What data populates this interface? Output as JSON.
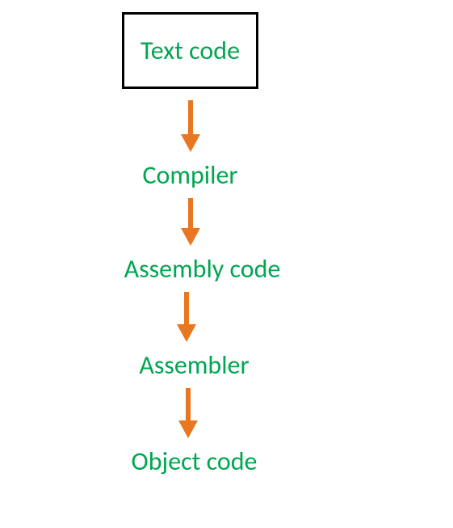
{
  "diagram": {
    "nodes": [
      {
        "label": "Text code",
        "boxed": true
      },
      {
        "label": "Compiler",
        "boxed": false
      },
      {
        "label": "Assembly code",
        "boxed": false
      },
      {
        "label": "Assembler",
        "boxed": false
      },
      {
        "label": "Object code",
        "boxed": false
      }
    ],
    "colors": {
      "text": "#00a651",
      "arrow": "#e87722",
      "box_border": "#000000"
    }
  }
}
